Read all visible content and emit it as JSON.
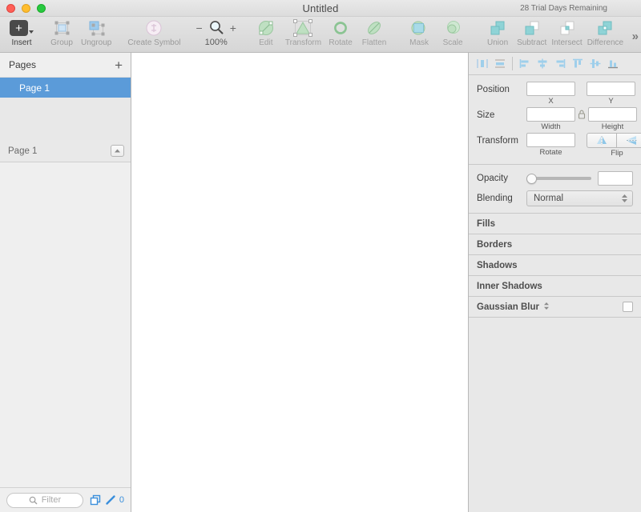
{
  "window": {
    "title": "Untitled",
    "trial_notice": "28 Trial Days Remaining",
    "traffic_lights": [
      "close-button",
      "minimize-button",
      "maximize-button"
    ]
  },
  "toolbar": {
    "items": [
      {
        "label": "Insert",
        "icon": "plus-square-icon",
        "enabled": true
      },
      {
        "label": "Group",
        "icon": "group-icon",
        "enabled": false
      },
      {
        "label": "Ungroup",
        "icon": "ungroup-icon",
        "enabled": false
      },
      {
        "label": "Create Symbol",
        "icon": "create-symbol-icon",
        "enabled": false
      },
      {
        "label": "Edit",
        "icon": "edit-icon",
        "enabled": false
      },
      {
        "label": "Transform",
        "icon": "transform-icon",
        "enabled": false
      },
      {
        "label": "Rotate",
        "icon": "rotate-icon",
        "enabled": false
      },
      {
        "label": "Flatten",
        "icon": "flatten-icon",
        "enabled": false
      },
      {
        "label": "Mask",
        "icon": "mask-icon",
        "enabled": false
      },
      {
        "label": "Scale",
        "icon": "scale-icon",
        "enabled": false
      },
      {
        "label": "Union",
        "icon": "union-icon",
        "enabled": false
      },
      {
        "label": "Subtract",
        "icon": "subtract-icon",
        "enabled": false
      },
      {
        "label": "Intersect",
        "icon": "intersect-icon",
        "enabled": false
      },
      {
        "label": "Difference",
        "icon": "difference-icon",
        "enabled": false
      }
    ],
    "zoom": {
      "level": "100%",
      "minus": "−",
      "plus": "+",
      "icon": "magnifier-icon"
    },
    "overflow_label": "»"
  },
  "sidebar": {
    "pages_header": "Pages",
    "add_page_label": "+",
    "pages": [
      {
        "name": "Page 1",
        "selected": true
      }
    ],
    "layers_header": "Page 1",
    "collapse_icon": "collapse-up-icon",
    "filter": {
      "placeholder": "Filter",
      "value": "",
      "icon": "search-icon"
    },
    "status_icons": [
      {
        "name": "duplicate-layers-icon"
      },
      {
        "name": "pencil-icon"
      }
    ],
    "layer_count": "0"
  },
  "inspector": {
    "align_buttons": [
      {
        "name": "distribute-horizontally-icon",
        "tooltip": "Distribute Horizontally"
      },
      {
        "name": "distribute-vertically-icon",
        "tooltip": "Distribute Vertically"
      },
      {
        "name": "align-left-icon",
        "tooltip": "Align Left"
      },
      {
        "name": "align-center-horizontal-icon",
        "tooltip": "Align Horizontal Centers"
      },
      {
        "name": "align-right-icon",
        "tooltip": "Align Right"
      },
      {
        "name": "align-top-icon",
        "tooltip": "Align Top"
      },
      {
        "name": "align-center-vertical-icon",
        "tooltip": "Align Vertical Centers"
      },
      {
        "name": "align-bottom-icon",
        "tooltip": "Align Bottom"
      }
    ],
    "geometry": {
      "position_label": "Position",
      "x_value": "",
      "x_sublabel": "X",
      "y_value": "",
      "y_sublabel": "Y",
      "size_label": "Size",
      "width_value": "",
      "width_sublabel": "Width",
      "height_value": "",
      "height_sublabel": "Height",
      "lock_icon": "lock-proportions-icon",
      "transform_label": "Transform",
      "rotate_value": "",
      "rotate_sublabel": "Rotate",
      "flip_sublabel": "Flip",
      "flip_horizontal_icon": "flip-horizontal-icon",
      "flip_vertical_icon": "flip-vertical-icon"
    },
    "appearance": {
      "opacity_label": "Opacity",
      "opacity_value": "",
      "opacity_percent": 0,
      "blending_label": "Blending",
      "blending_value": "Normal",
      "blending_options": [
        "Normal"
      ]
    },
    "sections": [
      {
        "title": "Fills",
        "has_checkbox": false,
        "has_dropdown": false
      },
      {
        "title": "Borders",
        "has_checkbox": false,
        "has_dropdown": false
      },
      {
        "title": "Shadows",
        "has_checkbox": false,
        "has_dropdown": false
      },
      {
        "title": "Inner Shadows",
        "has_checkbox": false,
        "has_dropdown": false
      },
      {
        "title": "Gaussian Blur",
        "has_checkbox": true,
        "has_dropdown": true
      }
    ]
  },
  "colors": {
    "selection_blue": "#5b9bd9",
    "accent_blue": "#3a8fdc",
    "toolbar_green": "#9fd3a8",
    "toolbar_teal": "#8fd3d6",
    "chrome_gray": "#e8e8e8"
  }
}
